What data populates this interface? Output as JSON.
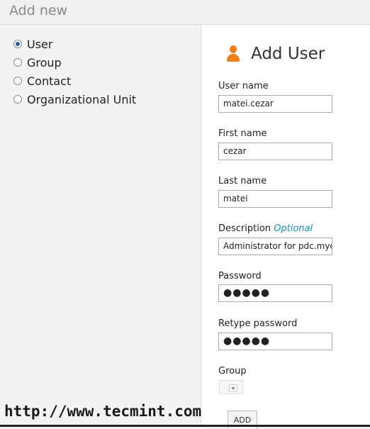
{
  "dialog": {
    "title": "Add new"
  },
  "object_types": [
    {
      "label": "User",
      "selected": true
    },
    {
      "label": "Group",
      "selected": false
    },
    {
      "label": "Contact",
      "selected": false
    },
    {
      "label": "Organizational Unit",
      "selected": false
    }
  ],
  "form": {
    "title": "Add User",
    "icon": "user-icon",
    "accent_color": "#ef7f1a",
    "username": {
      "label": "User name",
      "value": "matei.cezar"
    },
    "first_name": {
      "label": "First name",
      "value": "cezar"
    },
    "last_name": {
      "label": "Last name",
      "value": "matei"
    },
    "description": {
      "label": "Description",
      "optional_label": "Optional",
      "value": "Administrator for pdc.myd"
    },
    "password": {
      "label": "Password",
      "value": "●●●●●"
    },
    "retype_password": {
      "label": "Retype password",
      "value": "●●●●●"
    },
    "group": {
      "label": "Group",
      "value": ""
    },
    "add_label": "ADD"
  },
  "watermark": "http://www.tecmint.com"
}
